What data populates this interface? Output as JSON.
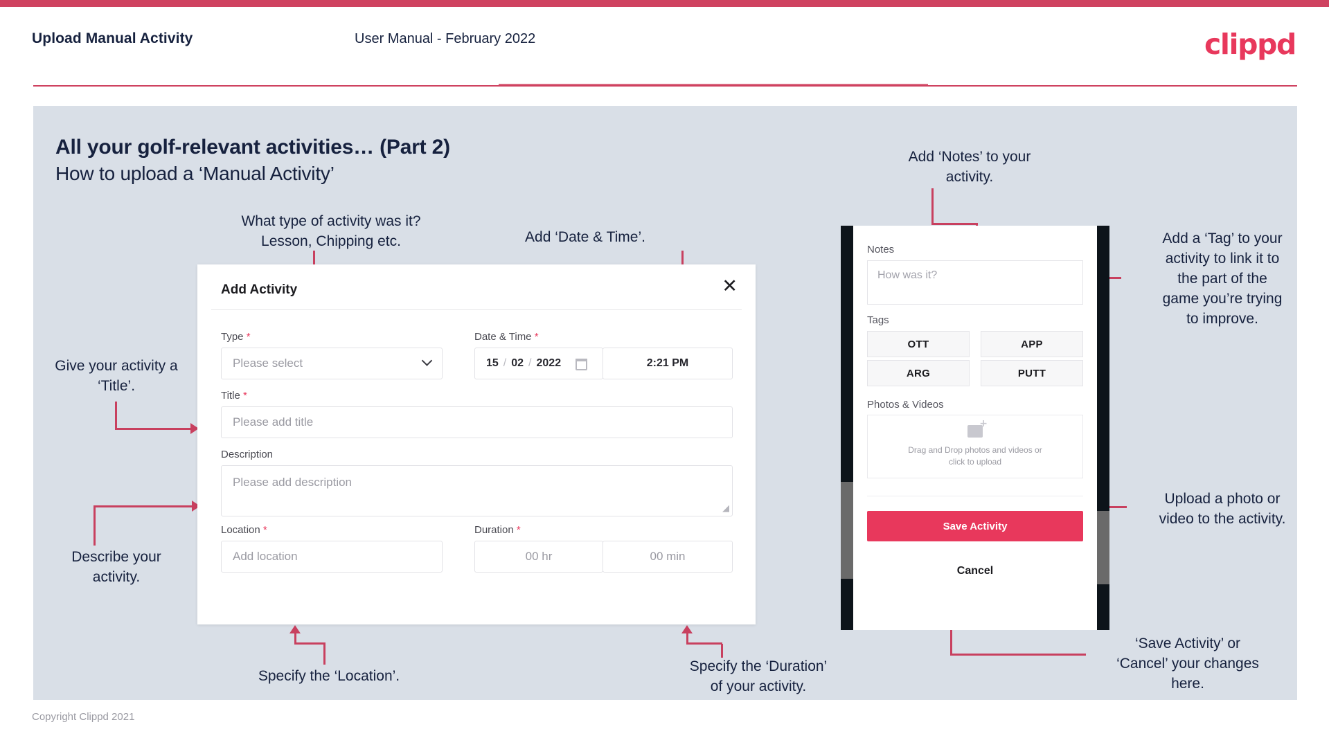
{
  "header": {
    "title": "Upload Manual Activity",
    "subtitle": "User Manual - February 2022",
    "logo": "clippd"
  },
  "slide": {
    "heading": "All your golf-relevant activities… (Part 2)",
    "subheading": "How to upload a ‘Manual Activity’"
  },
  "annotations": {
    "type": "What type of activity was it?\nLesson, Chipping etc.",
    "datetime": "Add ‘Date & Time’.",
    "title": "Give your activity a\n‘Title’.",
    "description": "Describe your\nactivity.",
    "location": "Specify the ‘Location’.",
    "duration": "Specify the ‘Duration’\nof your activity.",
    "notes": "Add ‘Notes’ to your\nactivity.",
    "tags": "Add a ‘Tag’ to your\nactivity to link it to\nthe part of the\ngame you’re trying\nto improve.",
    "upload": "Upload a photo or\nvideo to the activity.",
    "save": "‘Save Activity’ or\n‘Cancel’ your changes\nhere."
  },
  "dialog": {
    "title": "Add Activity",
    "close_icon": "close-icon",
    "fields": {
      "type": {
        "label": "Type",
        "required": "*",
        "value": "",
        "placeholder": "Please select"
      },
      "datetime": {
        "label": "Date & Time",
        "required": "*",
        "day": "15",
        "sep1": "/",
        "month": "02",
        "sep2": "/",
        "year": "2022",
        "time": "2:21 PM"
      },
      "title": {
        "label": "Title",
        "required": "*",
        "value": "",
        "placeholder": "Please add title"
      },
      "description": {
        "label": "Description",
        "required": "",
        "value": "",
        "placeholder": "Please add description"
      },
      "location": {
        "label": "Location",
        "required": "*",
        "value": "",
        "placeholder": "Add location"
      },
      "duration": {
        "label": "Duration",
        "required": "*",
        "hours_placeholder": "00 hr",
        "minutes_placeholder": "00 min"
      }
    }
  },
  "phone": {
    "notes": {
      "label": "Notes",
      "placeholder": "How was it?",
      "value": ""
    },
    "tags": {
      "label": "Tags",
      "options": [
        "OTT",
        "APP",
        "ARG",
        "PUTT"
      ]
    },
    "media": {
      "label": "Photos & Videos",
      "dropzone_line1": "Drag and Drop photos and videos or",
      "dropzone_line2": "click to upload",
      "icon": "add-image-icon"
    },
    "save_label": "Save Activity",
    "cancel_label": "Cancel"
  },
  "footer": {
    "copyright": "Copyright Clippd 2021"
  },
  "colors": {
    "brand_pink": "#e8385c",
    "accent_crimson": "#cf4260",
    "panel_bg": "#d9dfe7",
    "text_dark": "#16213e"
  }
}
